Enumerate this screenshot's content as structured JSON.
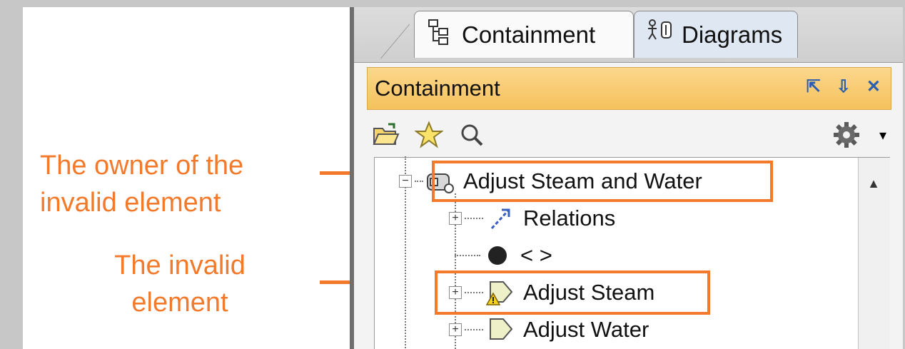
{
  "callouts": {
    "owner_line1": "The owner of the",
    "owner_line2": "invalid element",
    "invalid_line1": "The invalid",
    "invalid_line2": "element"
  },
  "tabs": [
    {
      "label": "Containment",
      "icon": "containment-tree-icon",
      "active": true
    },
    {
      "label": "Diagrams",
      "icon": "diagrams-icon",
      "active": false
    }
  ],
  "panel": {
    "title": "Containment",
    "title_buttons": [
      "float-window-icon",
      "pin-icon",
      "close-icon"
    ]
  },
  "toolbar": {
    "icons": [
      "open-folder-icon",
      "star-icon",
      "search-icon",
      "gear-icon",
      "dropdown-icon"
    ]
  },
  "tree": {
    "rows": [
      {
        "label": "Adjust Steam and Water",
        "icon": "activity-owner-icon",
        "expander": "−"
      },
      {
        "label": "Relations",
        "icon": "relations-icon",
        "expander": "+"
      },
      {
        "label": "< >",
        "icon": "initial-node-icon",
        "expander": ""
      },
      {
        "label": "Adjust Steam",
        "icon": "action-warning-icon",
        "expander": "+"
      },
      {
        "label": "Adjust Water",
        "icon": "action-icon",
        "expander": "+"
      }
    ]
  },
  "colors": {
    "callout": "#f47a2b",
    "panel_title": "#f6c15d",
    "frame_bg": "#c7c7c7"
  }
}
